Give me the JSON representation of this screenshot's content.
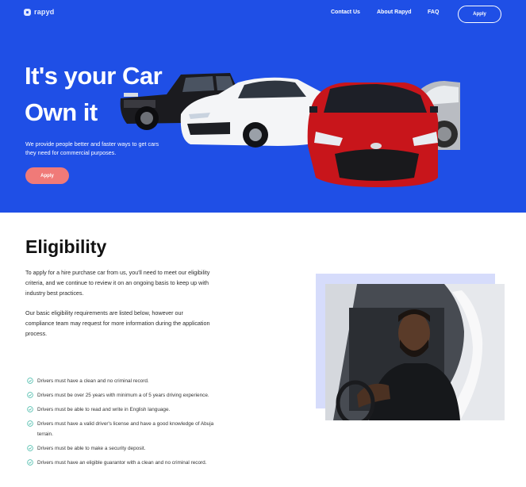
{
  "brand": {
    "logo_text": "rapyd"
  },
  "nav": {
    "contact": "Contact Us",
    "about": "About Rapyd",
    "faq": "FAQ",
    "apply": "Apply"
  },
  "hero": {
    "title_line1": "It's your Car",
    "title_line2": "Own it",
    "description": "We provide people better and faster ways to get cars they need for commercial purposes.",
    "apply": "Apply"
  },
  "eligibility": {
    "title": "Eligibility",
    "paragraph1": "To apply for a hire purchase car from us, you'll need to meet our eligibility criteria, and we continue to review it on an ongoing basis to keep up with industry best practices.",
    "paragraph2": "Our basic eligibility requirements are listed below, however our compliance team may request for more information during the application process.",
    "requirements": [
      "Drivers must have a clean and no criminal record.",
      "Drivers must be over 25 years with minimum a of 5 years driving experience.",
      "Drivers must be able to read and write in English language.",
      "Drivers must have a valid driver's license and have a good knowledge of Abuja terrain.",
      "Drivers must be able to make a security deposit.",
      "Drivers must have an eligible guarantor with a clean and no criminal record."
    ]
  },
  "colors": {
    "hero_blue": "#1f4fe6",
    "apply_coral": "#f07a78",
    "check_teal": "#3cb6a4",
    "photo_backdrop": "#d6dcfb"
  },
  "icons": {
    "requirement": "check-circle-icon",
    "logo": "rapyd-logo-icon"
  }
}
